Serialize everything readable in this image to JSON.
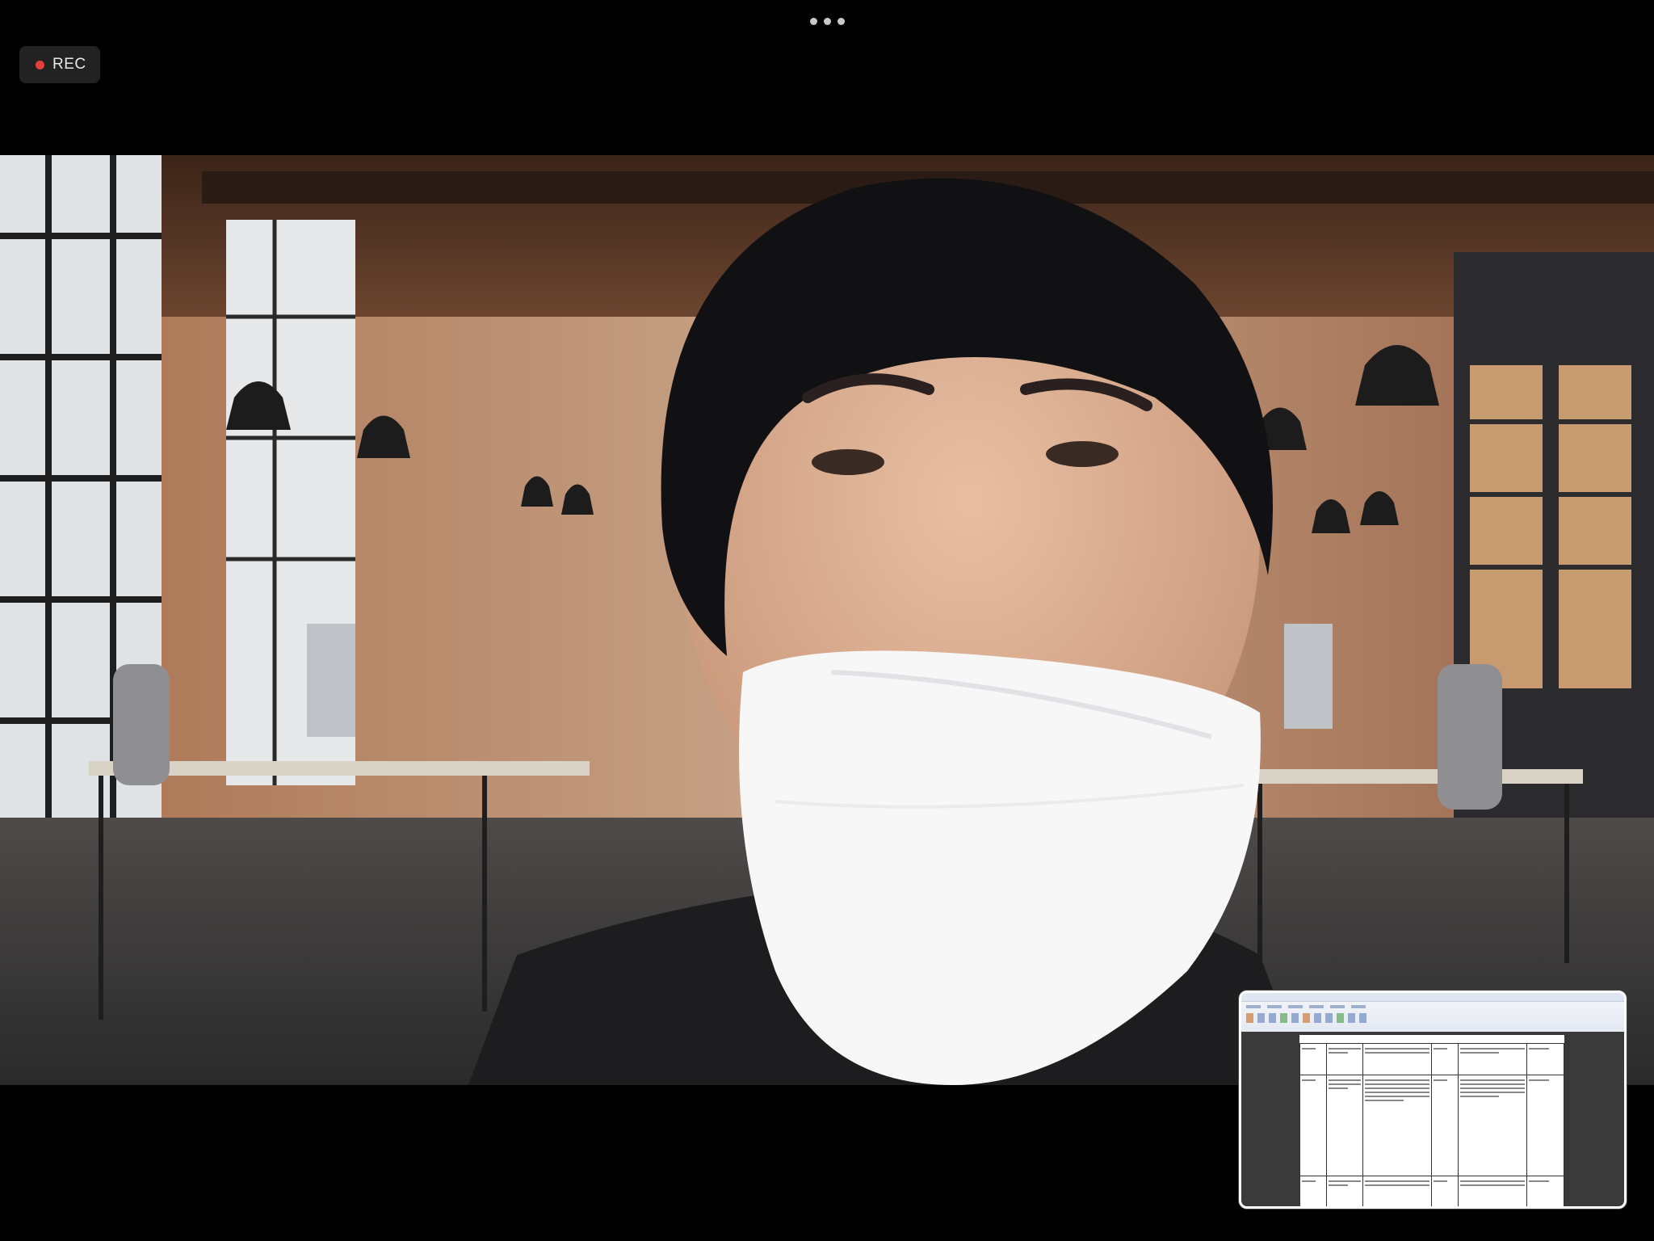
{
  "recording": {
    "label": "REC"
  },
  "menu": {
    "icon": "more-horizontal-icon"
  },
  "share_thumbnail": {
    "icon": "shared-screen-document"
  },
  "colors": {
    "background": "#000000",
    "rec_dot": "#e0413a",
    "rec_pill": "#222222"
  }
}
